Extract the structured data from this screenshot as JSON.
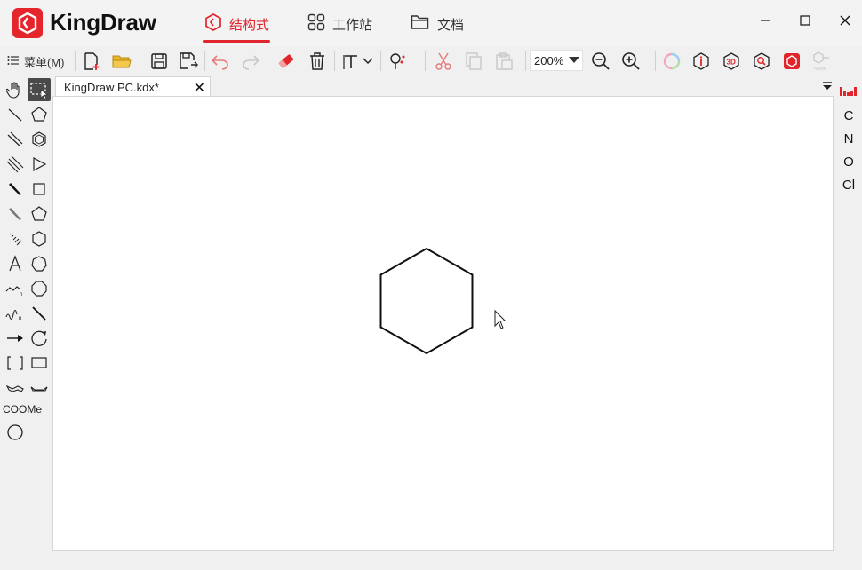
{
  "app": {
    "title": "KingDraw",
    "brand_color": "#e4262c"
  },
  "nav": {
    "tabs": [
      {
        "label": "结构式",
        "icon": "structure-icon",
        "active": true
      },
      {
        "label": "工作站",
        "icon": "workstation-icon",
        "active": false
      },
      {
        "label": "文档",
        "icon": "folder-icon",
        "active": false
      }
    ]
  },
  "toolbar": {
    "menu_label": "菜单(M)",
    "zoom_value": "200%",
    "items": [
      "new-file-icon",
      "open-folder-icon",
      "save-icon",
      "save-as-icon",
      "undo-icon",
      "redo-icon",
      "eraser-icon",
      "delete-icon",
      "text-tool-icon",
      "clean-structure-icon",
      "cut-icon",
      "copy-icon",
      "paste-icon",
      "zoom-out-icon",
      "zoom-in-icon",
      "color-ring-icon",
      "info-icon",
      "3d-view-icon",
      "search-structure-icon",
      "image-recognize-icon",
      "name-icon"
    ]
  },
  "left_tools": {
    "ester_label": "COOMe"
  },
  "document": {
    "tab_title": "KingDraw PC.kdx*",
    "close_symbol": "✕"
  },
  "elements": [
    "C",
    "N",
    "O",
    "Cl"
  ]
}
